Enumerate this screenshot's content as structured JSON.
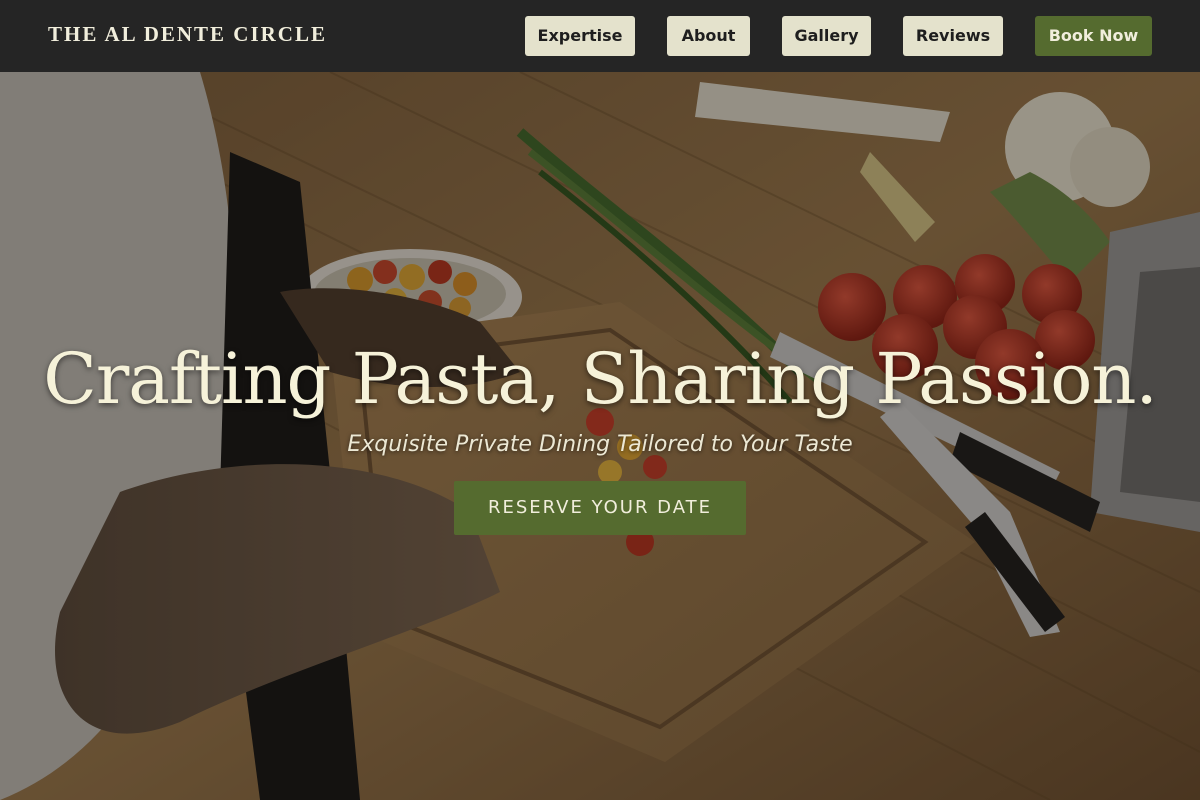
{
  "header": {
    "brand": "THE AL DENTE CIRCLE",
    "nav": [
      {
        "label": "Expertise"
      },
      {
        "label": "About"
      },
      {
        "label": "Gallery"
      },
      {
        "label": "Reviews"
      }
    ],
    "book_label": "Book Now"
  },
  "hero": {
    "heading": "Crafting Pasta, Sharing Passion.",
    "subheading": "Exquisite Private Dining Tailored to Your Taste",
    "cta_label": "RESERVE YOUR DATE",
    "image": "chef-chopping-vegetables-photo"
  },
  "colors": {
    "header_bg": "#252525",
    "nav_button_bg": "#e4e2cc",
    "accent_green": "#556b2f",
    "heading_text": "#f6f2d9"
  }
}
